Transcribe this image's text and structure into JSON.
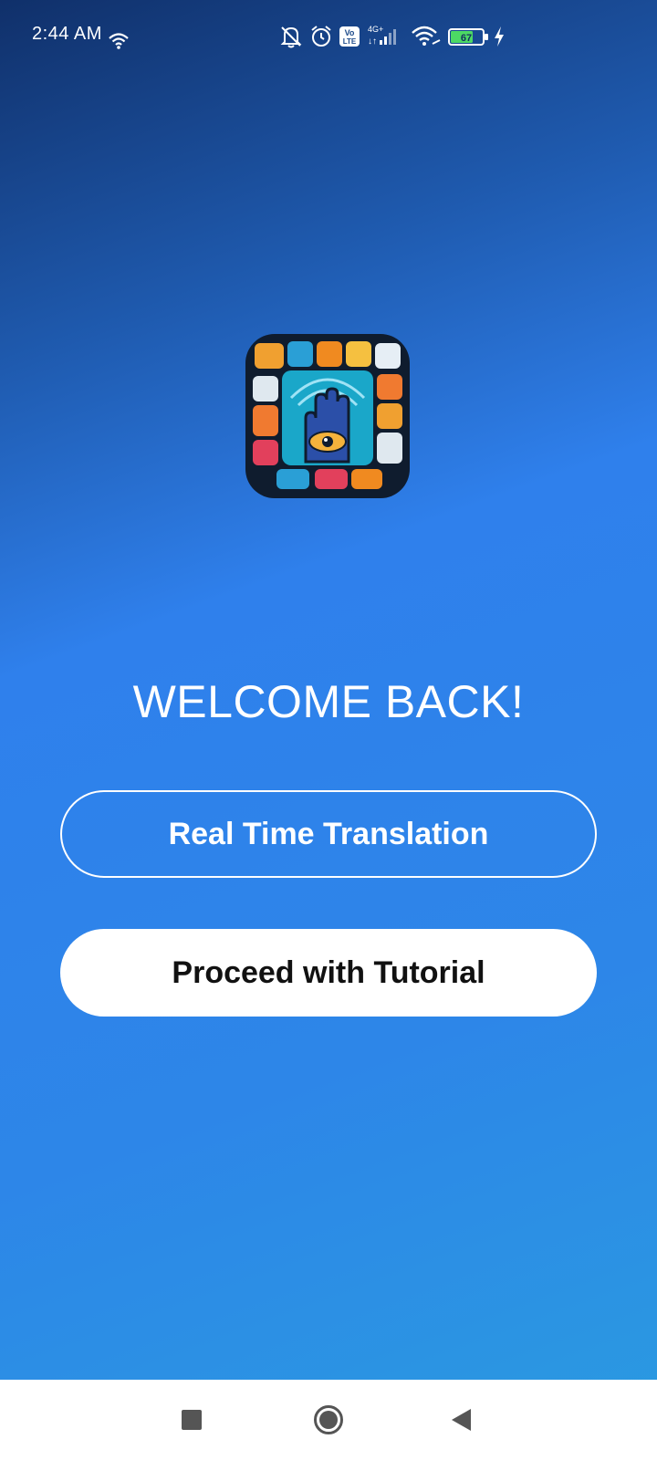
{
  "status_bar": {
    "time": "2:44 AM",
    "network_type": "4G+",
    "volte_label_top": "Vo",
    "volte_label_bottom": "LTE",
    "battery_level": "67",
    "icons": [
      "wifi-small-icon",
      "mute-icon",
      "alarm-icon",
      "volte-icon",
      "signal-icon",
      "wifi-icon",
      "battery-icon",
      "charging-icon"
    ]
  },
  "main": {
    "logo": "hand-eye-app-logo",
    "welcome_text": "WELCOME BACK!",
    "primary_button": "Real Time Translation",
    "secondary_button": "Proceed with Tutorial"
  },
  "nav_bar": {
    "icons": [
      "recents-icon",
      "home-icon",
      "back-icon"
    ]
  },
  "colors": {
    "gradient_top": "#10306a",
    "gradient_mid": "#2f80ec",
    "gradient_bottom": "#2a9be0",
    "button_text_dark": "#111111",
    "nav_icon": "#555555"
  }
}
